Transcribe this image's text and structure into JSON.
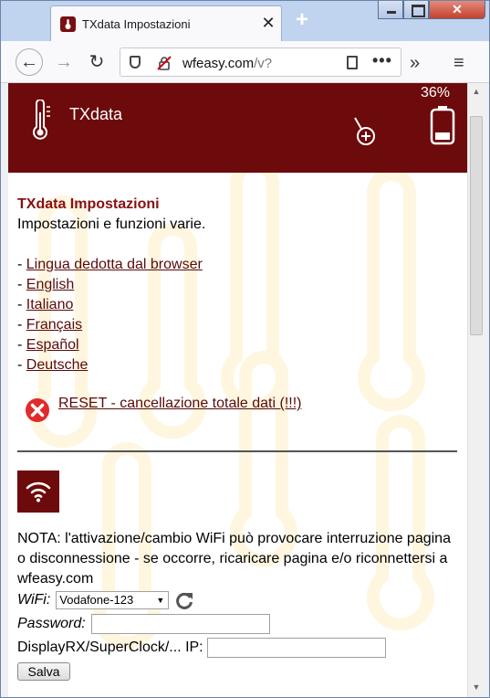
{
  "browser": {
    "tab_title": "TXdata Impostazioni",
    "tab_close": "✕",
    "new_tab": "+",
    "url_host": "wfeasy.com",
    "url_path": "/v?",
    "close_glyph": "✕"
  },
  "app": {
    "title": "TXdata",
    "battery_pct": "36%",
    "icons": [
      "thermometer-icon",
      "add-sensor-icon",
      "battery-icon"
    ]
  },
  "settings": {
    "title": "TXdata Impostazioni",
    "subtitle": "Impostazioni e funzioni varie.",
    "languages": [
      {
        "prefix": "- ",
        "label": "Lingua dedotta dal browser"
      },
      {
        "prefix": "- ",
        "label": "English"
      },
      {
        "prefix": "- ",
        "label": "Italiano"
      },
      {
        "prefix": "- ",
        "label": "Français"
      },
      {
        "prefix": "- ",
        "label": "Español"
      },
      {
        "prefix": "- ",
        "label": "Deutsche"
      }
    ],
    "reset_label": "RESET - cancellazione totale dati (!!!)"
  },
  "wifi": {
    "note": "NOTA: l'attivazione/cambio WiFi può provocare interruzione pagina o disconnessione - se occorre, ricaricare pagina e/o riconnettersi a wfeasy.com",
    "wifi_label": "WiFi:",
    "wifi_selected": "Vodafone-123",
    "password_label": "Password:",
    "password_value": "",
    "ip_label": "DisplayRX/SuperClock/... IP:",
    "ip_value": "",
    "save_label": "Salva"
  }
}
